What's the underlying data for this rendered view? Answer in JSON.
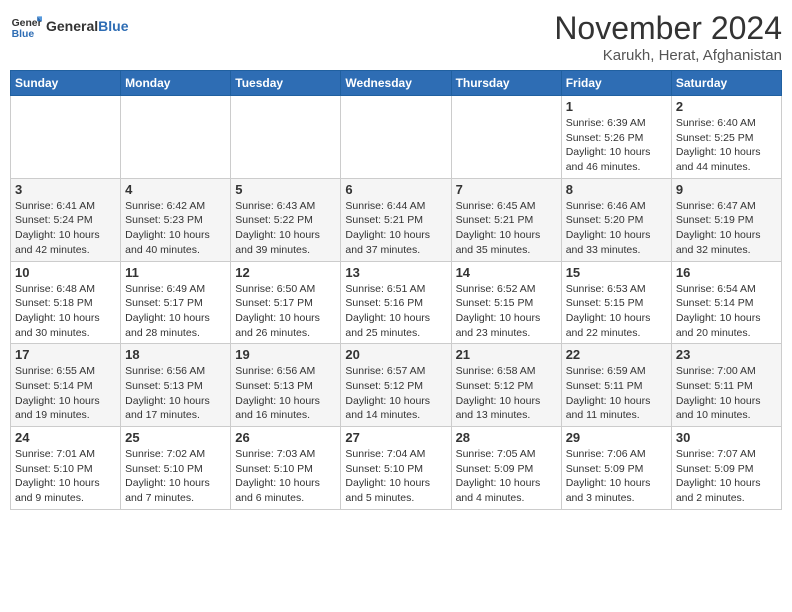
{
  "header": {
    "logo_line1": "General",
    "logo_line2": "Blue",
    "title": "November 2024",
    "location": "Karukh, Herat, Afghanistan"
  },
  "days_of_week": [
    "Sunday",
    "Monday",
    "Tuesday",
    "Wednesday",
    "Thursday",
    "Friday",
    "Saturday"
  ],
  "weeks": [
    [
      {
        "day": "",
        "info": ""
      },
      {
        "day": "",
        "info": ""
      },
      {
        "day": "",
        "info": ""
      },
      {
        "day": "",
        "info": ""
      },
      {
        "day": "",
        "info": ""
      },
      {
        "day": "1",
        "info": "Sunrise: 6:39 AM\nSunset: 5:26 PM\nDaylight: 10 hours and 46 minutes."
      },
      {
        "day": "2",
        "info": "Sunrise: 6:40 AM\nSunset: 5:25 PM\nDaylight: 10 hours and 44 minutes."
      }
    ],
    [
      {
        "day": "3",
        "info": "Sunrise: 6:41 AM\nSunset: 5:24 PM\nDaylight: 10 hours and 42 minutes."
      },
      {
        "day": "4",
        "info": "Sunrise: 6:42 AM\nSunset: 5:23 PM\nDaylight: 10 hours and 40 minutes."
      },
      {
        "day": "5",
        "info": "Sunrise: 6:43 AM\nSunset: 5:22 PM\nDaylight: 10 hours and 39 minutes."
      },
      {
        "day": "6",
        "info": "Sunrise: 6:44 AM\nSunset: 5:21 PM\nDaylight: 10 hours and 37 minutes."
      },
      {
        "day": "7",
        "info": "Sunrise: 6:45 AM\nSunset: 5:21 PM\nDaylight: 10 hours and 35 minutes."
      },
      {
        "day": "8",
        "info": "Sunrise: 6:46 AM\nSunset: 5:20 PM\nDaylight: 10 hours and 33 minutes."
      },
      {
        "day": "9",
        "info": "Sunrise: 6:47 AM\nSunset: 5:19 PM\nDaylight: 10 hours and 32 minutes."
      }
    ],
    [
      {
        "day": "10",
        "info": "Sunrise: 6:48 AM\nSunset: 5:18 PM\nDaylight: 10 hours and 30 minutes."
      },
      {
        "day": "11",
        "info": "Sunrise: 6:49 AM\nSunset: 5:17 PM\nDaylight: 10 hours and 28 minutes."
      },
      {
        "day": "12",
        "info": "Sunrise: 6:50 AM\nSunset: 5:17 PM\nDaylight: 10 hours and 26 minutes."
      },
      {
        "day": "13",
        "info": "Sunrise: 6:51 AM\nSunset: 5:16 PM\nDaylight: 10 hours and 25 minutes."
      },
      {
        "day": "14",
        "info": "Sunrise: 6:52 AM\nSunset: 5:15 PM\nDaylight: 10 hours and 23 minutes."
      },
      {
        "day": "15",
        "info": "Sunrise: 6:53 AM\nSunset: 5:15 PM\nDaylight: 10 hours and 22 minutes."
      },
      {
        "day": "16",
        "info": "Sunrise: 6:54 AM\nSunset: 5:14 PM\nDaylight: 10 hours and 20 minutes."
      }
    ],
    [
      {
        "day": "17",
        "info": "Sunrise: 6:55 AM\nSunset: 5:14 PM\nDaylight: 10 hours and 19 minutes."
      },
      {
        "day": "18",
        "info": "Sunrise: 6:56 AM\nSunset: 5:13 PM\nDaylight: 10 hours and 17 minutes."
      },
      {
        "day": "19",
        "info": "Sunrise: 6:56 AM\nSunset: 5:13 PM\nDaylight: 10 hours and 16 minutes."
      },
      {
        "day": "20",
        "info": "Sunrise: 6:57 AM\nSunset: 5:12 PM\nDaylight: 10 hours and 14 minutes."
      },
      {
        "day": "21",
        "info": "Sunrise: 6:58 AM\nSunset: 5:12 PM\nDaylight: 10 hours and 13 minutes."
      },
      {
        "day": "22",
        "info": "Sunrise: 6:59 AM\nSunset: 5:11 PM\nDaylight: 10 hours and 11 minutes."
      },
      {
        "day": "23",
        "info": "Sunrise: 7:00 AM\nSunset: 5:11 PM\nDaylight: 10 hours and 10 minutes."
      }
    ],
    [
      {
        "day": "24",
        "info": "Sunrise: 7:01 AM\nSunset: 5:10 PM\nDaylight: 10 hours and 9 minutes."
      },
      {
        "day": "25",
        "info": "Sunrise: 7:02 AM\nSunset: 5:10 PM\nDaylight: 10 hours and 7 minutes."
      },
      {
        "day": "26",
        "info": "Sunrise: 7:03 AM\nSunset: 5:10 PM\nDaylight: 10 hours and 6 minutes."
      },
      {
        "day": "27",
        "info": "Sunrise: 7:04 AM\nSunset: 5:10 PM\nDaylight: 10 hours and 5 minutes."
      },
      {
        "day": "28",
        "info": "Sunrise: 7:05 AM\nSunset: 5:09 PM\nDaylight: 10 hours and 4 minutes."
      },
      {
        "day": "29",
        "info": "Sunrise: 7:06 AM\nSunset: 5:09 PM\nDaylight: 10 hours and 3 minutes."
      },
      {
        "day": "30",
        "info": "Sunrise: 7:07 AM\nSunset: 5:09 PM\nDaylight: 10 hours and 2 minutes."
      }
    ]
  ]
}
